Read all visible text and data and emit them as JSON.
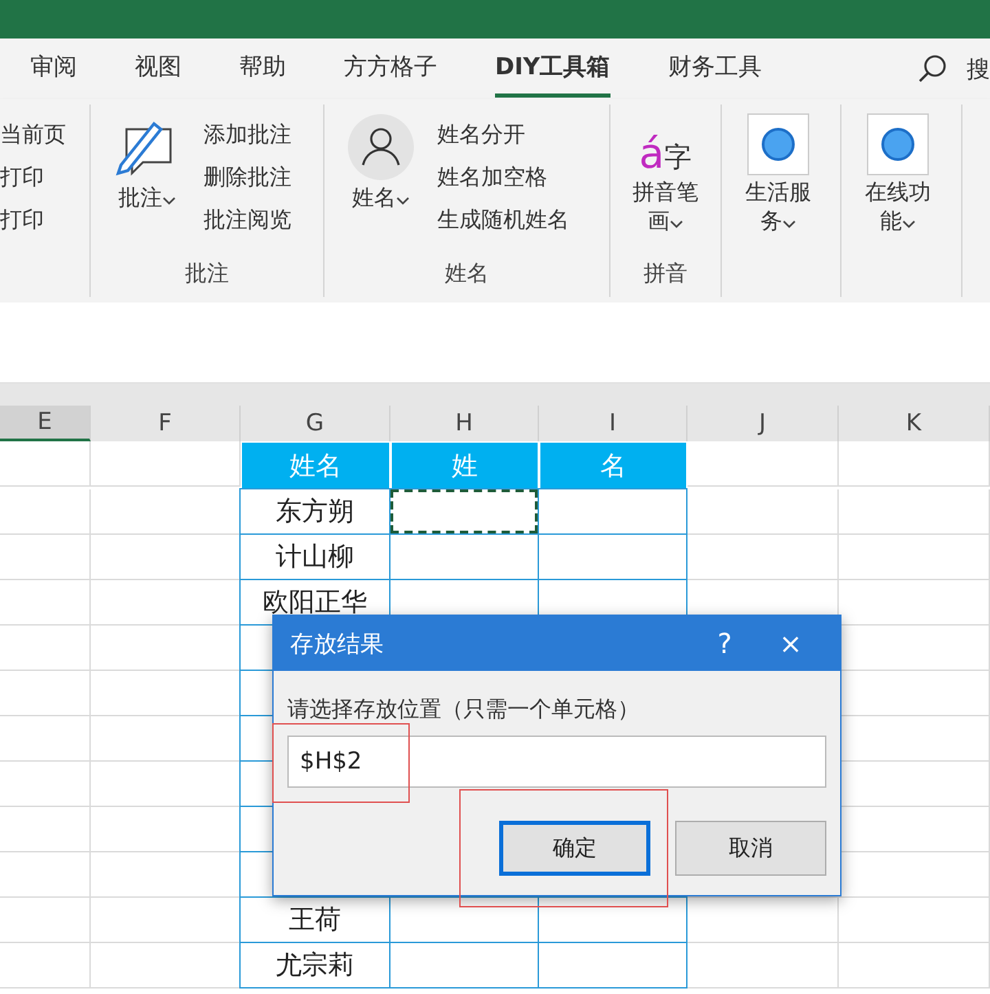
{
  "tabs": [
    {
      "label": "审阅",
      "selected": false
    },
    {
      "label": "视图",
      "selected": false
    },
    {
      "label": "帮助",
      "selected": false
    },
    {
      "label": "方方格子",
      "selected": false
    },
    {
      "label": "DIY工具箱",
      "selected": true
    },
    {
      "label": "财务工具",
      "selected": false
    }
  ],
  "search": {
    "label": "搜"
  },
  "ribbon": {
    "groups": [
      {
        "kind": "list",
        "items": [
          "当前页",
          "打印",
          "打印"
        ]
      },
      {
        "kind": "split",
        "big_label": "批注",
        "items": [
          "添加批注",
          "删除批注",
          "批注阅览"
        ],
        "label": "批注"
      },
      {
        "kind": "split",
        "big_label": "姓名",
        "items": [
          "姓名分开",
          "姓名加空格",
          "生成随机姓名"
        ],
        "label": "姓名"
      },
      {
        "kind": "pinyin",
        "icon_text": [
          "á",
          "字"
        ],
        "big_label": "拼音笔画",
        "label": "拼音"
      },
      {
        "kind": "big",
        "big_label": "生活服务"
      },
      {
        "kind": "big",
        "big_label": "在线功能"
      }
    ]
  },
  "sheet": {
    "columns": [
      {
        "label": "E",
        "selected": true
      },
      {
        "label": "F",
        "selected": false
      },
      {
        "label": "G",
        "selected": false
      },
      {
        "label": "H",
        "selected": false
      },
      {
        "label": "I",
        "selected": false
      },
      {
        "label": "J",
        "selected": false
      },
      {
        "label": "K",
        "selected": false
      }
    ],
    "header": [
      "姓名",
      "姓",
      "名"
    ],
    "rows_top": [
      {
        "name": "东方朔",
        "marquee": true
      },
      {
        "name": "计山柳",
        "marquee": false
      },
      {
        "name": "欧阳正华",
        "marquee": false
      }
    ],
    "rows_bottom": [
      "王荷",
      "尤宗莉"
    ]
  },
  "dialog": {
    "title": "存放结果",
    "help": "?",
    "close": "×",
    "prompt": "请选择存放位置（只需一个单元格）",
    "value": "$H$2",
    "buttons": [
      {
        "label": "确定",
        "selected": true
      },
      {
        "label": "取消",
        "selected": false
      }
    ]
  }
}
